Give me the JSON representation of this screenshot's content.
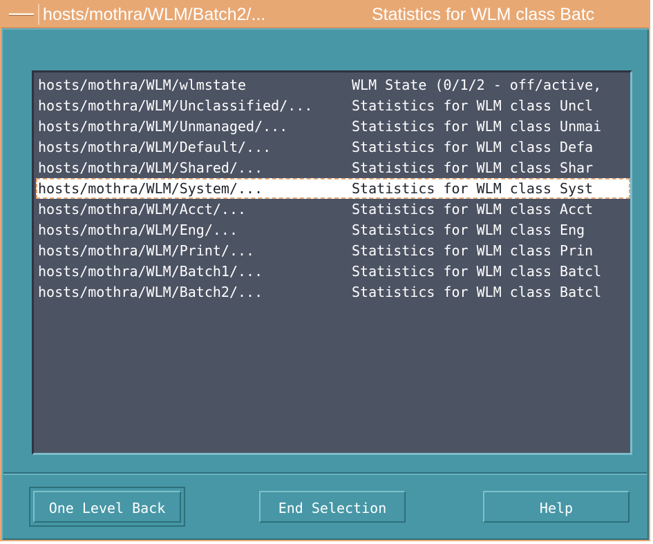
{
  "window": {
    "title_left": "hosts/mothra/WLM/Batch2/...",
    "title_right": "Statistics for WLM class Batc"
  },
  "list": {
    "items": [
      {
        "name": "hosts/mothra/WLM/wlmstate",
        "description": "WLM State (0/1/2 - off/active,"
      },
      {
        "name": "hosts/mothra/WLM/Unclassified/...",
        "description": "Statistics for WLM class Uncl"
      },
      {
        "name": "hosts/mothra/WLM/Unmanaged/...",
        "description": "Statistics for WLM class Unmai"
      },
      {
        "name": "hosts/mothra/WLM/Default/...",
        "description": "Statistics for WLM class Defa"
      },
      {
        "name": "hosts/mothra/WLM/Shared/...",
        "description": "Statistics for WLM class Shar"
      },
      {
        "name": "hosts/mothra/WLM/System/...",
        "description": "Statistics for WLM class Syst"
      },
      {
        "name": "hosts/mothra/WLM/Acct/...",
        "description": "Statistics for WLM class Acct"
      },
      {
        "name": "hosts/mothra/WLM/Eng/...",
        "description": "Statistics for WLM class Eng"
      },
      {
        "name": "hosts/mothra/WLM/Print/...",
        "description": "Statistics for WLM class Prin"
      },
      {
        "name": "hosts/mothra/WLM/Batch1/...",
        "description": "Statistics for WLM class Batcl"
      },
      {
        "name": "hosts/mothra/WLM/Batch2/...",
        "description": "Statistics for WLM class Batcl"
      }
    ],
    "selected_index": 5
  },
  "buttons": {
    "one_level_back": "One Level Back",
    "end_selection": "End Selection",
    "help": "Help"
  },
  "colors": {
    "title_bar": "#e8a874",
    "window_bg": "#4797a6",
    "list_bg": "#4c5363",
    "text": "#ffffff"
  }
}
